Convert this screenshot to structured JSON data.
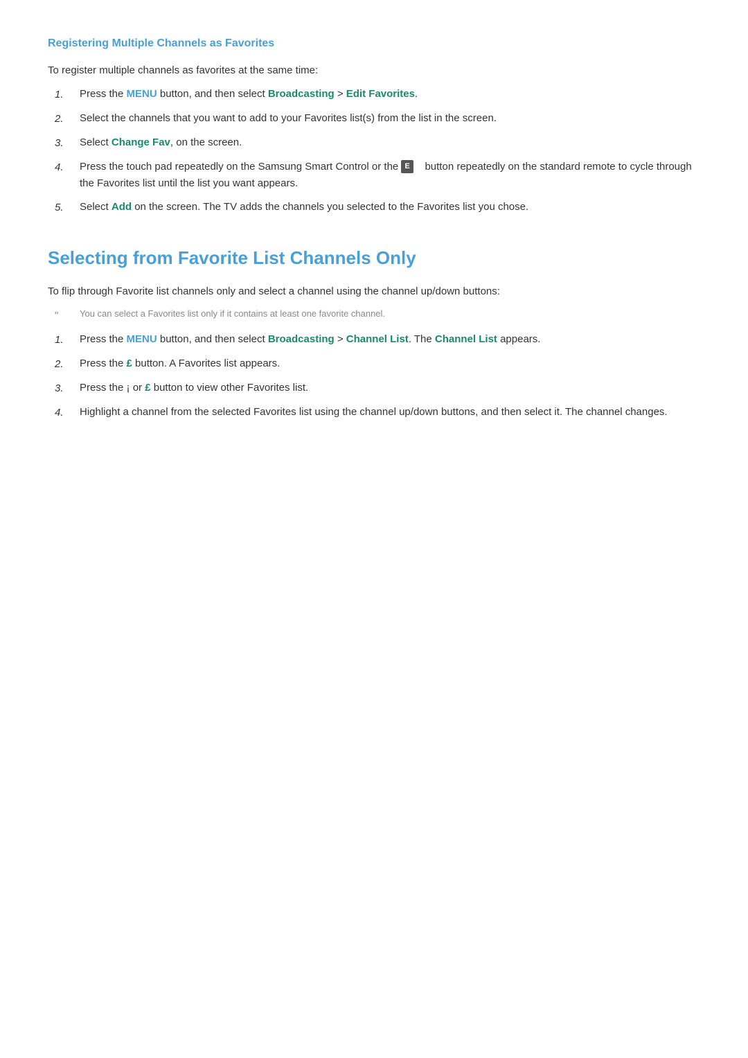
{
  "section1": {
    "title": "Registering Multiple Channels as Favorites",
    "intro": "To register multiple channels as favorites at the same time:",
    "steps": [
      {
        "number": "1.",
        "parts": [
          {
            "text": "Press the ",
            "type": "normal"
          },
          {
            "text": "MENU",
            "type": "blue"
          },
          {
            "text": " button, and then select ",
            "type": "normal"
          },
          {
            "text": "Broadcasting",
            "type": "teal"
          },
          {
            "text": " > ",
            "type": "normal"
          },
          {
            "text": "Edit Favorites",
            "type": "teal"
          },
          {
            "text": ".",
            "type": "normal"
          }
        ]
      },
      {
        "number": "2.",
        "parts": [
          {
            "text": "Select the channels that you want to add to your Favorites list(s) from the list in the screen.",
            "type": "normal"
          }
        ]
      },
      {
        "number": "3.",
        "parts": [
          {
            "text": "Select ",
            "type": "normal"
          },
          {
            "text": "Change Fav",
            "type": "teal"
          },
          {
            "text": ", on the screen.",
            "type": "normal"
          }
        ]
      },
      {
        "number": "4.",
        "parts": [
          {
            "text": "Press the touch pad repeatedly on the Samsung Smart Control or the ",
            "type": "normal"
          },
          {
            "text": "E",
            "type": "button"
          },
          {
            "text": "   button repeatedly on the standard remote to cycle through the Favorites list until the list you want appears.",
            "type": "normal"
          }
        ]
      },
      {
        "number": "5.",
        "parts": [
          {
            "text": "Select ",
            "type": "normal"
          },
          {
            "text": "Add",
            "type": "teal"
          },
          {
            "text": " on the screen. The TV adds the channels you selected to the Favorites list you chose.",
            "type": "normal"
          }
        ]
      }
    ]
  },
  "section2": {
    "title": "Selecting from Favorite List Channels Only",
    "intro": "To flip through Favorite list channels only and select a channel using the channel up/down buttons:",
    "note": "You can select a Favorites list only if it contains at least one favorite channel.",
    "steps": [
      {
        "number": "1.",
        "parts": [
          {
            "text": "Press the ",
            "type": "normal"
          },
          {
            "text": "MENU",
            "type": "blue"
          },
          {
            "text": " button, and then select ",
            "type": "normal"
          },
          {
            "text": "Broadcasting",
            "type": "teal"
          },
          {
            "text": " > ",
            "type": "normal"
          },
          {
            "text": "Channel List",
            "type": "teal"
          },
          {
            "text": ". The ",
            "type": "normal"
          },
          {
            "text": "Channel List",
            "type": "teal"
          },
          {
            "text": " appears.",
            "type": "normal"
          }
        ]
      },
      {
        "number": "2.",
        "parts": [
          {
            "text": "Press the ",
            "type": "normal"
          },
          {
            "text": "£",
            "type": "teal"
          },
          {
            "text": " button. A Favorites list appears.",
            "type": "normal"
          }
        ]
      },
      {
        "number": "3.",
        "parts": [
          {
            "text": "Press the ",
            "type": "normal"
          },
          {
            "text": "¡",
            "type": "normal"
          },
          {
            "text": " or ",
            "type": "normal"
          },
          {
            "text": "£",
            "type": "teal"
          },
          {
            "text": " button to view other Favorites list.",
            "type": "normal"
          }
        ]
      },
      {
        "number": "4.",
        "parts": [
          {
            "text": "Highlight a channel from the selected Favorites list using the channel up/down buttons, and then select it. The channel changes.",
            "type": "normal"
          }
        ]
      }
    ]
  }
}
